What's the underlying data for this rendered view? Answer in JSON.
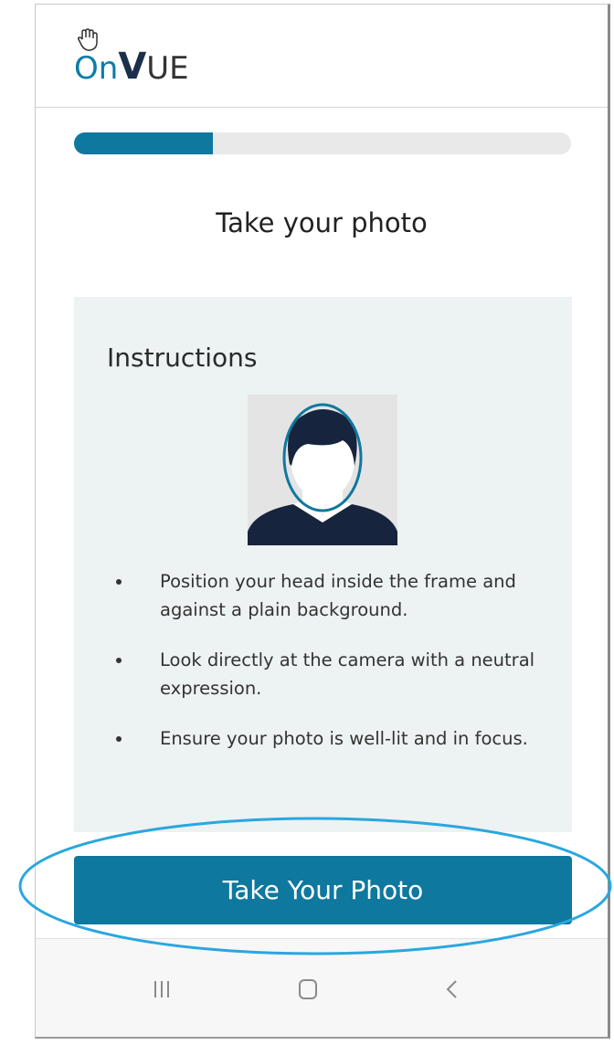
{
  "header": {
    "logo": {
      "brand_on": "On",
      "brand_v": "V",
      "brand_ue": "UE"
    }
  },
  "progress": {
    "fraction": 0.28
  },
  "page": {
    "title": "Take your photo"
  },
  "instructions": {
    "heading": "Instructions",
    "items": [
      {
        "text": "Position your head inside the frame and against a plain background."
      },
      {
        "text": "Look directly at the camera with a neutral expression."
      },
      {
        "text": "Ensure your photo is well-lit and in focus."
      }
    ]
  },
  "cta": {
    "label": "Take Your Photo"
  },
  "colors": {
    "accent": "#0f789e",
    "panel_bg": "#edf2f2",
    "highlight": "#29a7e0"
  },
  "icons": {
    "hand": "hand-icon",
    "avatar": "avatar-illustration",
    "recents": "recents-icon",
    "home": "home-icon",
    "back": "back-icon"
  }
}
